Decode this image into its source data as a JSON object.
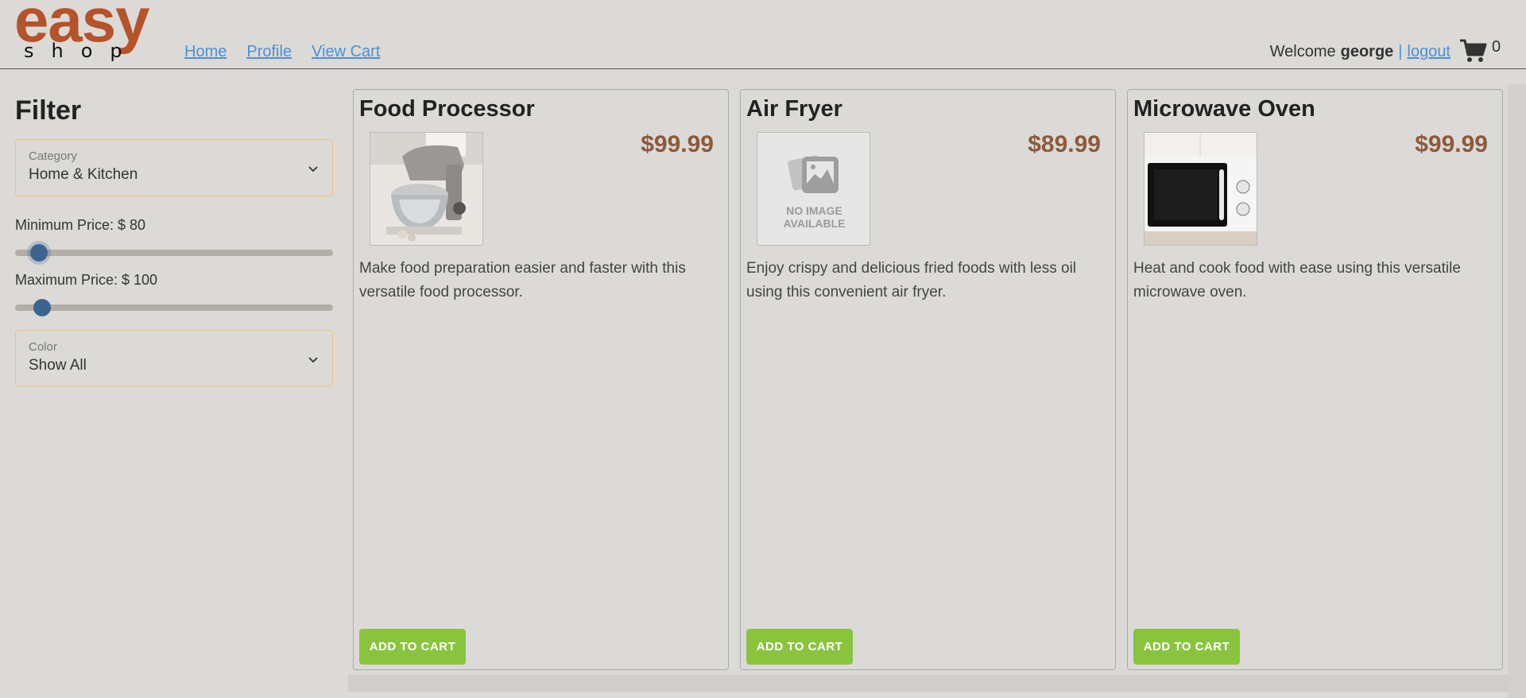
{
  "header": {
    "logo": {
      "top": "easy",
      "bottom": "shop"
    },
    "nav": [
      {
        "label": "Home"
      },
      {
        "label": "Profile"
      },
      {
        "label": "View Cart"
      }
    ],
    "welcome_prefix": "Welcome",
    "username": "george",
    "separator": "|",
    "logout_label": "logout",
    "cart_icon": "shopping-cart-icon",
    "cart_count": "0"
  },
  "filter": {
    "title": "Filter",
    "category": {
      "label": "Category",
      "value": "Home & Kitchen"
    },
    "min_price": {
      "label": "Minimum Price: $ 80",
      "value": 80
    },
    "max_price": {
      "label": "Maximum Price: $ 100",
      "value": 100
    },
    "color": {
      "label": "Color",
      "value": "Show All"
    }
  },
  "products": [
    {
      "name": "Food Processor",
      "price": "$99.99",
      "image": "food-processor-photo",
      "description": "Make food preparation easier and faster with this versatile food processor.",
      "button": "ADD TO CART"
    },
    {
      "name": "Air Fryer",
      "price": "$89.99",
      "image": "no-image-available",
      "image_text_1": "NO IMAGE",
      "image_text_2": "AVAILABLE",
      "description": "Enjoy crispy and delicious fried foods with less oil using this convenient air fryer.",
      "button": "ADD TO CART"
    },
    {
      "name": "Microwave Oven",
      "price": "$99.99",
      "image": "microwave-oven-photo",
      "description": "Heat and cook food with ease using this versatile microwave oven.",
      "button": "ADD TO CART"
    }
  ],
  "colors": {
    "logo": "#b5532a",
    "link": "#4a90d9",
    "price": "#8b5a3c",
    "button": "#8ac43f",
    "slider_thumb": "#3d6491",
    "background": "#dcdad7"
  }
}
